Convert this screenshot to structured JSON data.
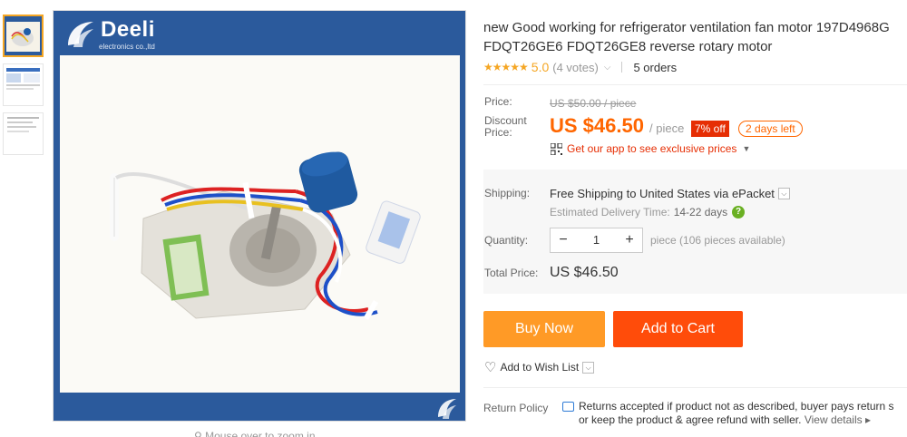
{
  "gallery": {
    "brand_name": "Deeli",
    "brand_sub": "electronics co.,ltd",
    "zoom_hint": "Mouse over to zoom in"
  },
  "product": {
    "title_line1": "new Good working for refrigerator ventilation fan motor 197D4968G",
    "title_line2": "FDQT26GE6 FDQT26GE8 reverse rotary motor"
  },
  "rating": {
    "stars": "★★★★★",
    "value": "5.0",
    "votes": "(4 votes)",
    "orders": "5 orders"
  },
  "price": {
    "price_label": "Price:",
    "original": "US $50.00 / piece",
    "discount_label_1": "Discount",
    "discount_label_2": "Price:",
    "current": "US $46.50",
    "unit": "/ piece",
    "off_badge": "7% off",
    "days_left": "2 days left",
    "app_promo": "Get our app to see exclusive prices"
  },
  "shipping": {
    "label": "Shipping:",
    "method_prefix": "Free Shipping",
    "to": "to",
    "destination": "United States",
    "via": "via ePacket",
    "est_label": "Estimated Delivery Time:",
    "est_days": "14-22 days"
  },
  "quantity": {
    "label": "Quantity:",
    "minus": "−",
    "value": "1",
    "plus": "+",
    "available": "piece (106 pieces available)"
  },
  "total": {
    "label": "Total Price:",
    "value": "US $46.50"
  },
  "actions": {
    "buy_now": "Buy Now",
    "add_to_cart": "Add to Cart",
    "wishlist": "Add to Wish List"
  },
  "return_policy": {
    "label": "Return Policy",
    "line1": "Returns accepted if product not as described, buyer pays return s",
    "line2": "or keep the product & agree refund with seller.",
    "view_details": "View details ▸"
  },
  "colors": {
    "accent_orange": "#ff6600",
    "buy_now": "#ff9a26",
    "add_to_cart": "#ff4c0a",
    "badge_red": "#e62e04",
    "star": "#f5a623",
    "image_frame": "#2b5a9c"
  }
}
